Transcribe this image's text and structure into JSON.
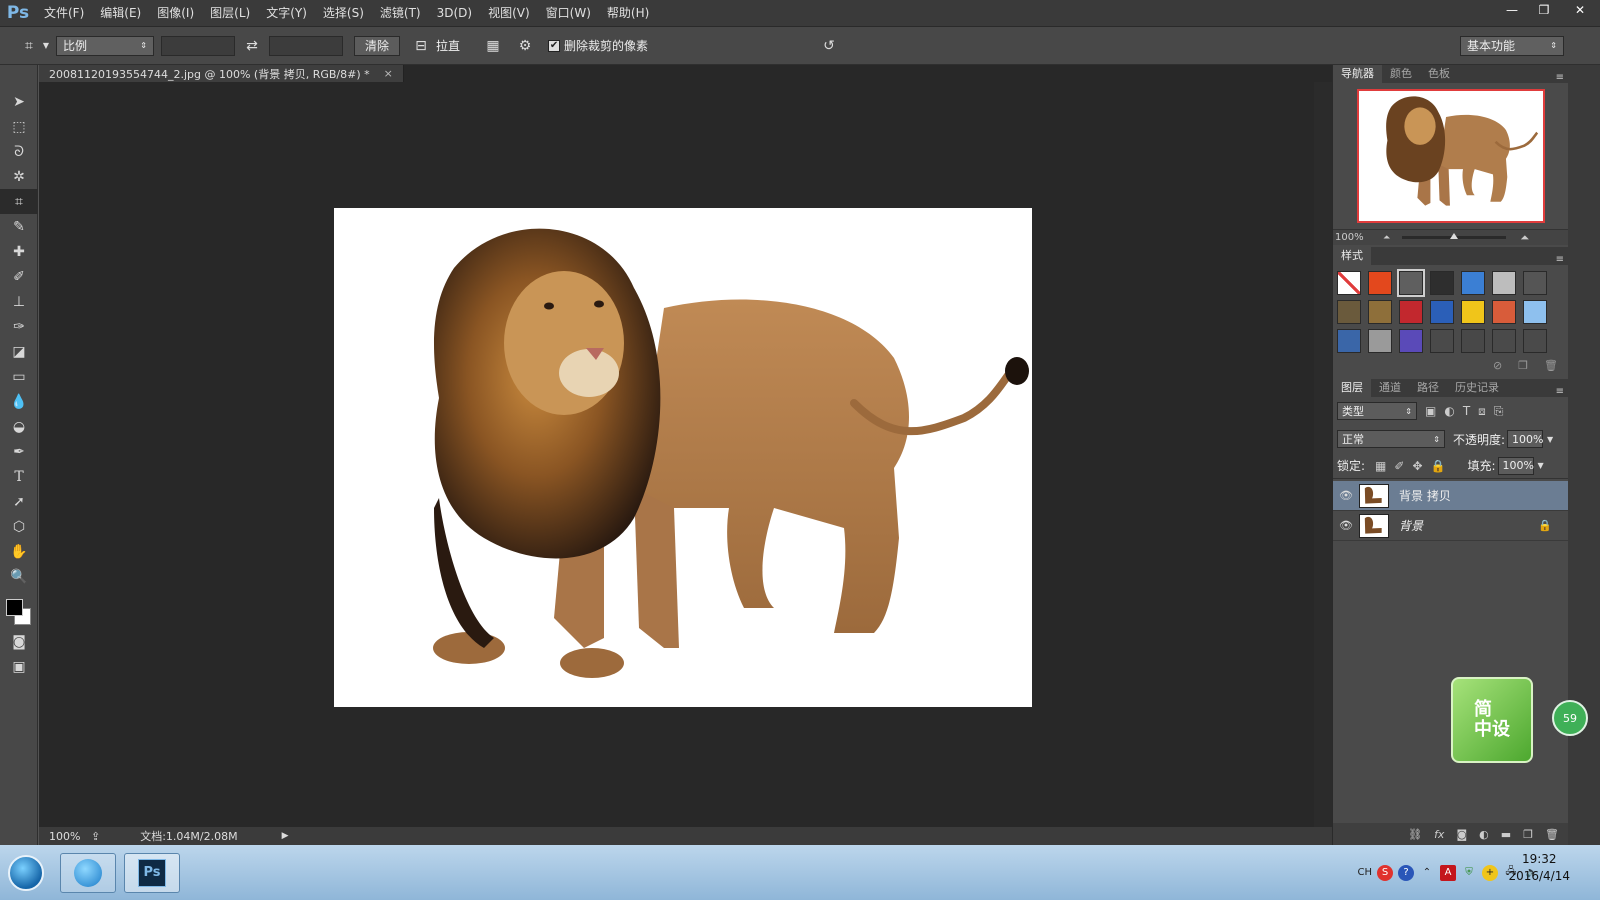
{
  "app": {
    "logo": "Ps"
  },
  "menu": [
    "文件(F)",
    "编辑(E)",
    "图像(I)",
    "图层(L)",
    "文字(Y)",
    "选择(S)",
    "滤镜(T)",
    "3D(D)",
    "视图(V)",
    "窗口(W)",
    "帮助(H)"
  ],
  "window_controls": {
    "minimize": "—",
    "restore": "❐",
    "close": "✕"
  },
  "options": {
    "ratio_select": "比例",
    "clear_button": "清除",
    "straighten_label": "拉直",
    "delete_cropped_checkbox": "✔",
    "delete_cropped_label": "删除裁剪的像素",
    "workspace": "基本功能"
  },
  "document": {
    "tab_title": "20081120193554744_2.jpg @ 100% (背景 拷贝, RGB/8#) *",
    "tab_close": "×",
    "status_zoom": "100%",
    "status_doc": "文档:1.04M/2.08M"
  },
  "panels": {
    "top_tabs": [
      "导航器",
      "颜色",
      "色板"
    ],
    "nav_zoom": "100%",
    "styles_title": "样式",
    "style_swatches": [
      "#ffffff",
      "#e3481d",
      "#5f5f5f",
      "#2e2e2e",
      "#3b7fd4",
      "#bdbdbd",
      "#555555",
      "#6a5a3c",
      "#8e6f3a",
      "#c2282e",
      "#2b5fb8",
      "#f0c51a",
      "#d85c3a",
      "#8ec0ee",
      "#3a66a8",
      "#9a9a9a",
      "#5a4ab8",
      "#4a4a4a",
      "#484848",
      "#4a4a4a",
      "#4a4a4a"
    ],
    "layer_tabs": [
      "图层",
      "通道",
      "路径",
      "历史记录"
    ],
    "filter_label": "类型",
    "blend_mode": "正常",
    "opacity_label": "不透明度:",
    "opacity_value": "100%",
    "lock_label": "锁定:",
    "fill_label": "填充:",
    "fill_value": "100%",
    "layers": [
      {
        "name": "背景 拷贝",
        "selected": true,
        "locked": false
      },
      {
        "name": "背景",
        "selected": false,
        "locked": true
      }
    ]
  },
  "widget": {
    "text": "简\n中设",
    "badge": "59"
  },
  "taskbar": {
    "tray_text": "CH",
    "time": "19:32",
    "date": "2016/4/14"
  },
  "colors": {
    "bg_dark": "#282828",
    "panel": "#4a4a4a",
    "accent_red": "#e03c3c",
    "selection": "#6b7d93"
  }
}
